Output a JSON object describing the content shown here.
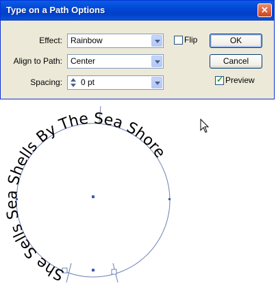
{
  "window": {
    "title": "Type on a Path Options",
    "close_glyph": "✕"
  },
  "effect": {
    "label": "Effect:",
    "value": "Rainbow"
  },
  "align": {
    "label": "Align to Path:",
    "value": "Center"
  },
  "spacing": {
    "label": "Spacing:",
    "value": "0 pt"
  },
  "flip": {
    "label": "Flip",
    "checked": false
  },
  "buttons": {
    "ok": "OK",
    "cancel": "Cancel"
  },
  "preview": {
    "label": "Preview",
    "checked": true,
    "check_glyph": "✓"
  },
  "artwork": {
    "text": "She Sells Sea Shells By The Sea Shore",
    "text_color": "#000000",
    "path_color": "#6a7fb5"
  },
  "cursor": {
    "icon": "arrow-pointer-icon"
  }
}
